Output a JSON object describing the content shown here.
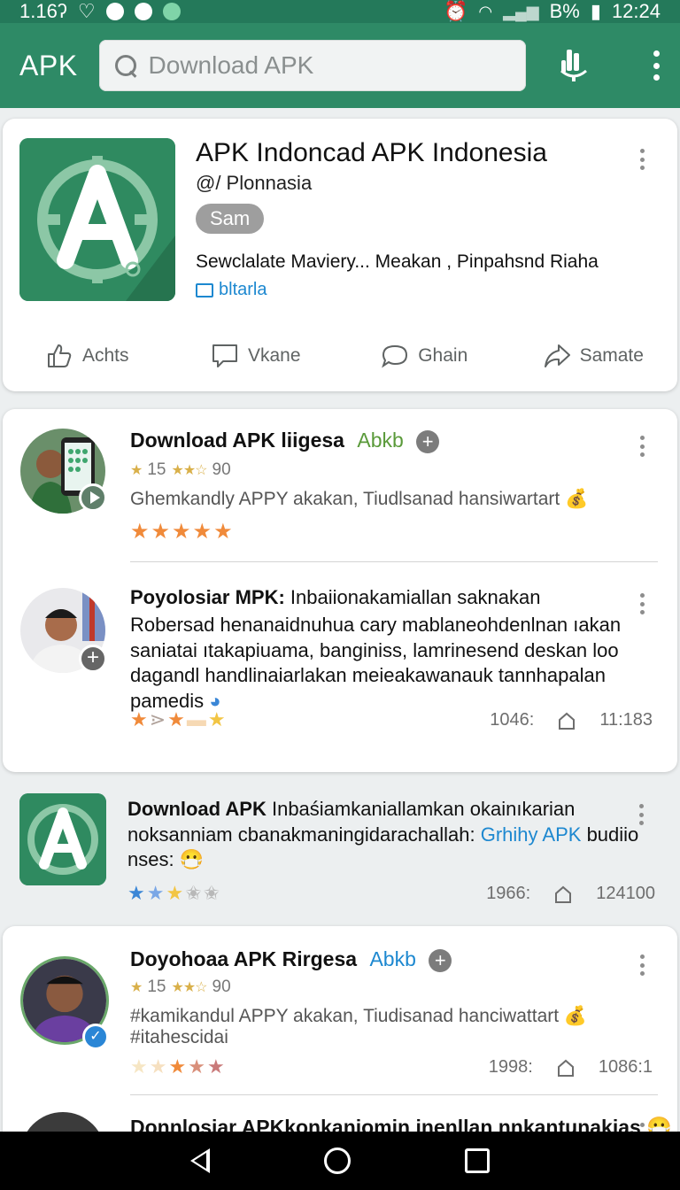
{
  "status_bar": {
    "time_left": "1.16ʔ",
    "battery": "B%",
    "time_right": "12:24"
  },
  "app_bar": {
    "title": "APK",
    "search_placeholder": "Download APK"
  },
  "hero": {
    "title": "APK Indoncad APK Indonesia",
    "developer": "@/ Plonnasia",
    "chip": "Sam",
    "description": "Sewclalate Maviery... Meakan , Pinpahsnd Riaha",
    "link": "bltarla",
    "actions": [
      "Achts",
      "Vkane",
      "Ghain",
      "Samate"
    ]
  },
  "feed": [
    {
      "title": "Download APK liigesa",
      "tag": "Abkb",
      "rating_count": "15",
      "rating_value": "90",
      "body": "Ghemkandly APPY akakan, Tiudlsanad hansiwartart",
      "stars": [
        "★",
        "★",
        "★",
        "★",
        "★"
      ]
    },
    {
      "title_bold": "Poyolosiar MPK:",
      "title_rest": " Inbaiionakamiallan saknakan",
      "text": "Robersad henanaidnuhua cary mablaneohdenlnan ıakan saniatai ıtakapiuama, banginiss, lamrinesend deskan loo dagandl handlinaiarlakan meieakawanauk tannhapalan pamedis",
      "stars": [
        "★",
        "⋗",
        "★",
        "▬",
        "★"
      ],
      "meta_left": "1046:",
      "meta_right": "11:183"
    }
  ],
  "loose_post": {
    "title_bold": "Download APK",
    "title_rest": " Inbaśiamkaniallamkan okainıkarian noksanniam cbanakmaningidarachallah:",
    "highlight": "Grhihy APK",
    "last": "budiio nses:",
    "meta_left": "1966:",
    "meta_right": "124100"
  },
  "post3": {
    "title": "Doyohoaa APK Rirgesa",
    "tag": "Abkb",
    "rating_count": "15",
    "rating_value": "90",
    "body1": "#kamikandul APPY akakan, Tiudisanad hanciwattart",
    "body2": "#itahescidai",
    "meta_left": "1998:",
    "meta_right": "1086:1"
  },
  "post4": {
    "title": "Donnlosiar APKkonkaniomin inenllan nnkantunakias"
  },
  "colors": {
    "primary": "#2e8a66",
    "status_bar": "#24795a",
    "star_orange": "#f08a3a",
    "star_gold": "#f2c544",
    "star_blue": "#3a86d6",
    "link_blue": "#1d88d0"
  }
}
